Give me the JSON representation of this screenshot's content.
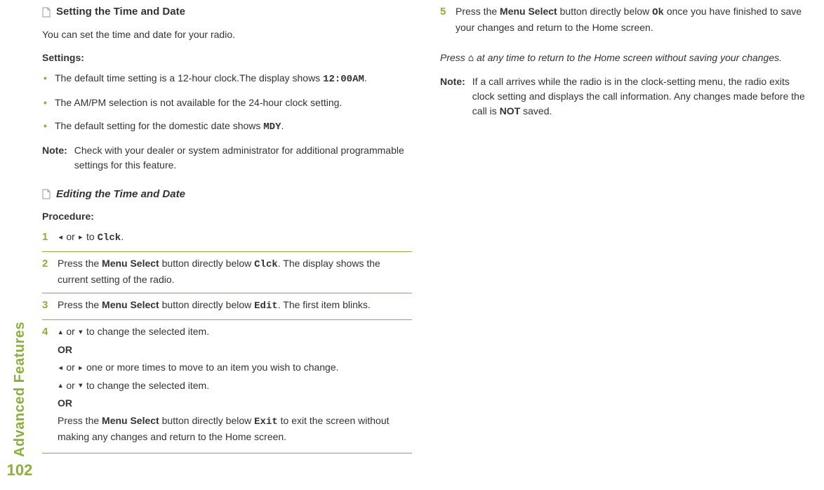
{
  "sidebar": {
    "section": "Advanced Features",
    "page": "102"
  },
  "h1": "Setting the Time and Date",
  "intro": "You can set the time and date for your radio.",
  "settings_label": "Settings:",
  "bullets": {
    "b1a": "The default time setting is a 12-hour clock.The display shows ",
    "b1b": "12:00AM",
    "b1c": ".",
    "b2": "The AM/PM selection is not available for the 24-hour clock setting.",
    "b3a": "The default setting for the domestic date shows ",
    "b3b": "MDY",
    "b3c": "."
  },
  "note1": {
    "label": "Note:",
    "text": "Check with your dealer or system administrator for additional programmable settings for this feature."
  },
  "h2": "Editing the Time and Date",
  "procedure_label": "Procedure:",
  "icons": {
    "left": "◂",
    "right": "▸",
    "up": "▴",
    "down": "▾",
    "home": "⌂"
  },
  "words": {
    "or": " or ",
    "to": " to ",
    "OR": "OR"
  },
  "steps": {
    "s1": {
      "clck": "Clck",
      "end": "."
    },
    "s2": {
      "a": "Press the ",
      "ms": "Menu Select",
      "b": " button directly below ",
      "clck": "Clck",
      "c": ". The display shows the current setting of the radio."
    },
    "s3": {
      "a": "Press the ",
      "ms": "Menu Select",
      "b": " button directly below ",
      "edit": "Edit",
      "c": ". The first item blinks."
    },
    "s4": {
      "line1": " to change the selected item.",
      "line2": " one or more times to move to an item you wish to change.",
      "line3": " to change the selected item.",
      "line4a": "Press the ",
      "ms": "Menu Select",
      "line4b": " button directly below ",
      "exit": "Exit",
      "line4c": " to exit the screen without making any changes and return to the Home screen."
    },
    "s5": {
      "a": "Press the ",
      "ms": "Menu Select",
      "b": " button directly below ",
      "ok": "Ok",
      "c": " once you have finished to save your changes and return to the Home screen."
    }
  },
  "closing": {
    "a": "Press ",
    "b": " at any time to return to the Home screen without saving your changes."
  },
  "note2": {
    "label": "Note:",
    "a": "If a call arrives while the radio is in the clock-setting menu, the radio exits clock setting and displays the call information. Any changes made before the call is ",
    "not": "NOT",
    "b": " saved."
  }
}
